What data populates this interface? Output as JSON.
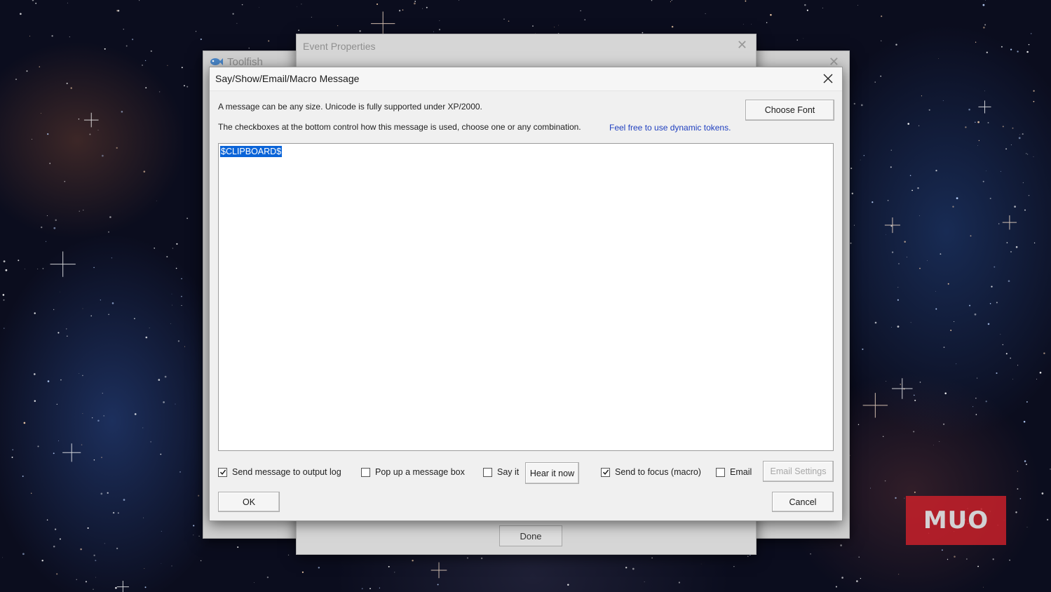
{
  "background_window": {
    "title": "Toolfish",
    "close_glyph": "✕"
  },
  "event_properties": {
    "title": "Event Properties",
    "close_glyph": "✕",
    "done_label": "Done"
  },
  "dialog": {
    "title": "Say/Show/Email/Macro Message",
    "info_line_1": "A message can be any size.  Unicode is fully supported under XP/2000.",
    "info_line_2": "The checkboxes at the bottom control how this message is used, choose one or any combination.",
    "dynamic_tokens_link": "Feel free to use dynamic tokens.",
    "choose_font_label": "Choose Font",
    "message_text": "$CLIPBOARD$",
    "options": {
      "send_to_output_log": {
        "label": "Send message to output log",
        "checked": true
      },
      "pop_up_message_box": {
        "label": "Pop up a message box",
        "checked": false
      },
      "say_it": {
        "label": "Say it",
        "checked": false
      },
      "send_to_focus": {
        "label": "Send to focus (macro)",
        "checked": true
      },
      "email": {
        "label": "Email",
        "checked": false
      }
    },
    "hear_it_now_label": "Hear it now",
    "email_settings_label": "Email Settings",
    "ok_label": "OK",
    "cancel_label": "Cancel"
  },
  "watermark": {
    "text": "MUO",
    "color": "#c8202a"
  },
  "colors": {
    "selection": "#0a64d8",
    "link": "#1f3fbf",
    "dialog_bg": "#f0f0f0"
  }
}
